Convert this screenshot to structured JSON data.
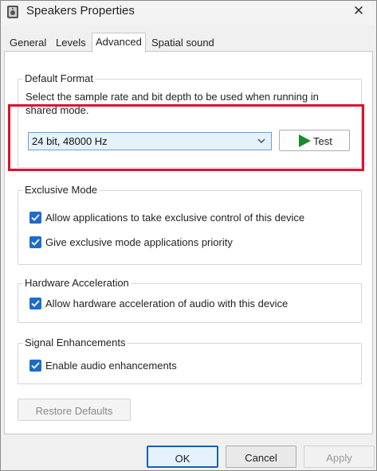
{
  "window": {
    "title": "Speakers Properties",
    "close_glyph": "✕",
    "icon": "speaker-icon"
  },
  "tabs": [
    {
      "label": "General",
      "active": false
    },
    {
      "label": "Levels",
      "active": false
    },
    {
      "label": "Advanced",
      "active": true
    },
    {
      "label": "Spatial sound",
      "active": false
    }
  ],
  "default_format": {
    "title": "Default Format",
    "description": "Select the sample rate and bit depth to be used when running in shared mode.",
    "selected_format": "24 bit, 48000 Hz",
    "test_label": "Test",
    "highlight_color": "#e0102c"
  },
  "exclusive_mode": {
    "title": "Exclusive Mode",
    "options": [
      {
        "label": "Allow applications to take exclusive control of this device",
        "checked": true
      },
      {
        "label": "Give exclusive mode applications priority",
        "checked": true
      }
    ]
  },
  "hardware_acceleration": {
    "title": "Hardware Acceleration",
    "options": [
      {
        "label": "Allow hardware acceleration of audio with this device",
        "checked": true
      }
    ]
  },
  "signal_enhancements": {
    "title": "Signal Enhancements",
    "options": [
      {
        "label": "Enable audio enhancements",
        "checked": true
      }
    ]
  },
  "buttons": {
    "restore_defaults": "Restore Defaults",
    "ok": "OK",
    "cancel": "Cancel",
    "apply": "Apply"
  },
  "colors": {
    "accent": "#1f6cc7",
    "play_green": "#1c8a2e"
  }
}
